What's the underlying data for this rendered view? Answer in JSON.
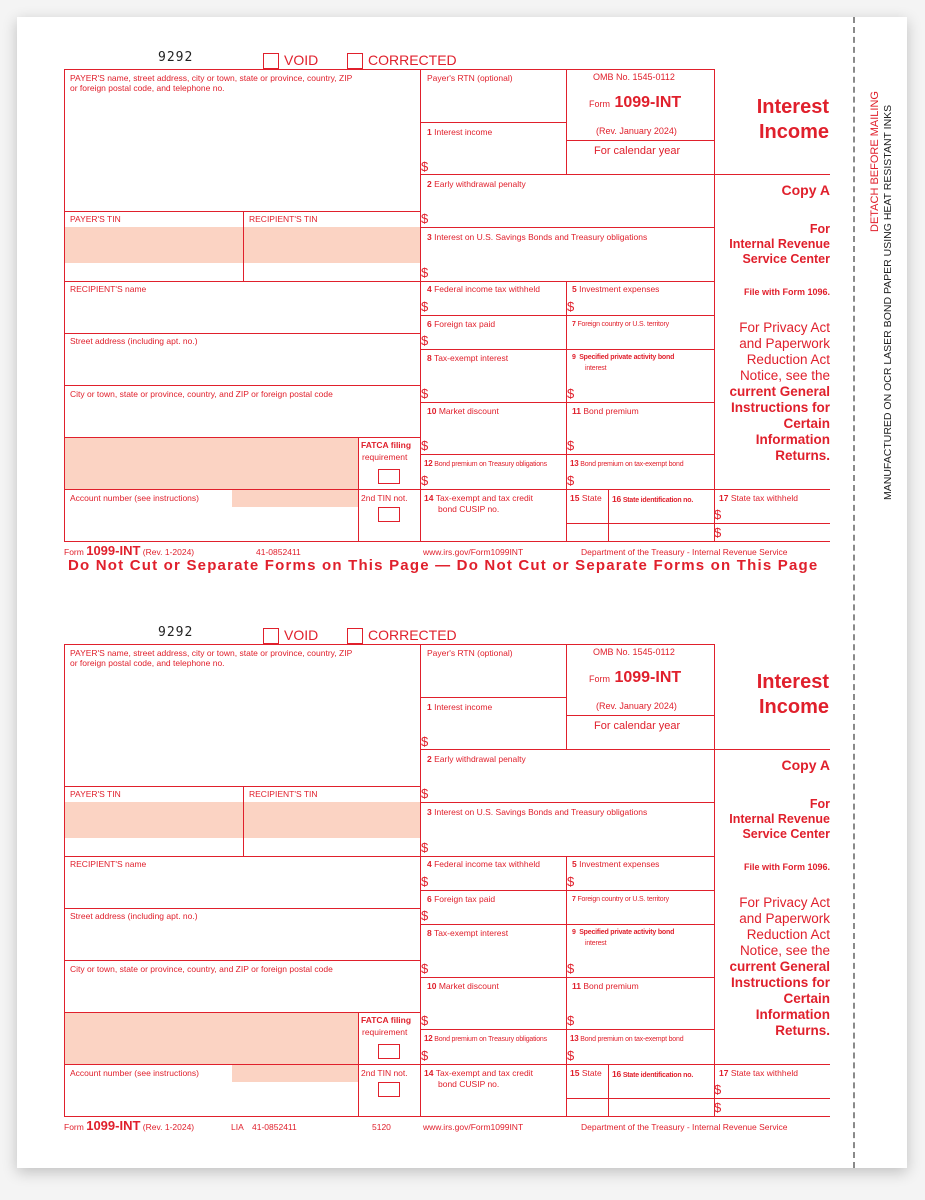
{
  "forms": [
    {
      "control_number": "9292",
      "void_label": "VOID",
      "corrected_label": "CORRECTED",
      "payer_info_label_line1": "PAYER'S name, street address, city or town, state or province, country, ZIP",
      "payer_info_label_line2": "or foreign postal code, and telephone no.",
      "payer_rtn_label": "Payer's RTN (optional)",
      "omb_no": "OMB No. 1545-0112",
      "form_word": "Form",
      "form_number": "1099-INT",
      "revision": "(Rev. January 2024)",
      "calendar_year": "For calendar year",
      "title_line1": "Interest",
      "title_line2": "Income",
      "copy": "Copy A",
      "for_irs_line1": "For",
      "for_irs_line2": "Internal Revenue",
      "for_irs_line3": "Service Center",
      "file_with": "File with Form 1096.",
      "privacy_lines": [
        "For Privacy Act",
        "and Paperwork",
        "Reduction Act",
        "Notice, see the"
      ],
      "instructions_lines": [
        "current General",
        "Instructions for",
        "Certain",
        "Information",
        "Returns."
      ],
      "payer_tin": "PAYER'S TIN",
      "recipient_tin": "RECIPIENT'S TIN",
      "recipient_name": "RECIPIENT'S name",
      "street_address": "Street address (including apt. no.)",
      "city_line": "City or town, state or province, country, and ZIP or foreign postal code",
      "fatca_line1": "FATCA filing",
      "fatca_line2": "requirement",
      "account_number": "Account number (see instructions)",
      "second_tin": "2nd TIN not.",
      "boxes": {
        "b1": {
          "num": "1",
          "label": "Interest income"
        },
        "b2": {
          "num": "2",
          "label": "Early withdrawal penalty"
        },
        "b3": {
          "num": "3",
          "label": "Interest on U.S. Savings Bonds and Treasury obligations"
        },
        "b4": {
          "num": "4",
          "label": "Federal income tax withheld"
        },
        "b5": {
          "num": "5",
          "label": "Investment expenses"
        },
        "b6": {
          "num": "6",
          "label": "Foreign tax paid"
        },
        "b7": {
          "num": "7",
          "label": "Foreign country or U.S. territory"
        },
        "b8": {
          "num": "8",
          "label": "Tax-exempt interest"
        },
        "b9": {
          "num": "9",
          "label": "Specified private activity bond",
          "label2": "interest"
        },
        "b10": {
          "num": "10",
          "label": "Market discount"
        },
        "b11": {
          "num": "11",
          "label": "Bond premium"
        },
        "b12": {
          "num": "12",
          "label": "Bond premium on Treasury obligations"
        },
        "b13": {
          "num": "13",
          "label": "Bond premium on tax-exempt bond"
        },
        "b14": {
          "num": "14",
          "label": "Tax-exempt and tax credit",
          "label2": "bond CUSIP no."
        },
        "b15": {
          "num": "15",
          "label": "State"
        },
        "b16": {
          "num": "16",
          "label": "State identification no."
        },
        "b17": {
          "num": "17",
          "label": "State tax withheld"
        }
      },
      "dollar_sign": "$",
      "footer": {
        "form_word": "Form",
        "form_number": "1099-INT",
        "rev": "(Rev. 1-2024)",
        "lia": "",
        "catalog": "41-0852411",
        "code": "",
        "url": "www.irs.gov/Form1099INT",
        "dept": "Department of the Treasury - Internal Revenue Service"
      },
      "warning": "Do Not Cut or Separate Forms on This Page  —  Do Not Cut or Separate Forms on This Page"
    },
    {
      "control_number": "9292",
      "void_label": "VOID",
      "corrected_label": "CORRECTED",
      "payer_info_label_line1": "PAYER'S name, street address, city or town, state or province, country, ZIP",
      "payer_info_label_line2": "or foreign postal code, and telephone no.",
      "payer_rtn_label": "Payer's RTN (optional)",
      "omb_no": "OMB No. 1545-0112",
      "form_word": "Form",
      "form_number": "1099-INT",
      "revision": "(Rev. January 2024)",
      "calendar_year": "For calendar year",
      "title_line1": "Interest",
      "title_line2": "Income",
      "copy": "Copy A",
      "for_irs_line1": "For",
      "for_irs_line2": "Internal Revenue",
      "for_irs_line3": "Service Center",
      "file_with": "File with Form 1096.",
      "privacy_lines": [
        "For Privacy Act",
        "and Paperwork",
        "Reduction Act",
        "Notice, see the"
      ],
      "instructions_lines": [
        "current General",
        "Instructions for",
        "Certain",
        "Information",
        "Returns."
      ],
      "payer_tin": "PAYER'S TIN",
      "recipient_tin": "RECIPIENT'S TIN",
      "recipient_name": "RECIPIENT'S name",
      "street_address": "Street address (including apt. no.)",
      "city_line": "City or town, state or province, country, and ZIP or foreign postal code",
      "fatca_line1": "FATCA filing",
      "fatca_line2": "requirement",
      "account_number": "Account number (see instructions)",
      "second_tin": "2nd TIN not.",
      "boxes": {
        "b1": {
          "num": "1",
          "label": "Interest income"
        },
        "b2": {
          "num": "2",
          "label": "Early withdrawal penalty"
        },
        "b3": {
          "num": "3",
          "label": "Interest on U.S. Savings Bonds and Treasury obligations"
        },
        "b4": {
          "num": "4",
          "label": "Federal income tax withheld"
        },
        "b5": {
          "num": "5",
          "label": "Investment expenses"
        },
        "b6": {
          "num": "6",
          "label": "Foreign tax paid"
        },
        "b7": {
          "num": "7",
          "label": "Foreign country or U.S. territory"
        },
        "b8": {
          "num": "8",
          "label": "Tax-exempt interest"
        },
        "b9": {
          "num": "9",
          "label": "Specified private activity bond",
          "label2": "interest"
        },
        "b10": {
          "num": "10",
          "label": "Market discount"
        },
        "b11": {
          "num": "11",
          "label": "Bond premium"
        },
        "b12": {
          "num": "12",
          "label": "Bond premium on Treasury obligations"
        },
        "b13": {
          "num": "13",
          "label": "Bond premium on tax-exempt bond"
        },
        "b14": {
          "num": "14",
          "label": "Tax-exempt and tax credit",
          "label2": "bond CUSIP no."
        },
        "b15": {
          "num": "15",
          "label": "State"
        },
        "b16": {
          "num": "16",
          "label": "State identification no."
        },
        "b17": {
          "num": "17",
          "label": "State tax withheld"
        }
      },
      "dollar_sign": "$",
      "footer": {
        "form_word": "Form",
        "form_number": "1099-INT",
        "rev": "(Rev. 1-2024)",
        "lia": "LIA",
        "catalog": "41-0852411",
        "code": "5120",
        "url": "www.irs.gov/Form1099INT",
        "dept": "Department of the Treasury - Internal Revenue Service"
      },
      "warning": ""
    }
  ],
  "side": {
    "detach": "DETACH BEFORE MAILING",
    "manufactured": "MANUFACTURED ON OCR LASER BOND PAPER USING HEAT RESISTANT INKS"
  },
  "colors": {
    "form_red": "#e0202c",
    "shade": "#fbd3c3"
  }
}
